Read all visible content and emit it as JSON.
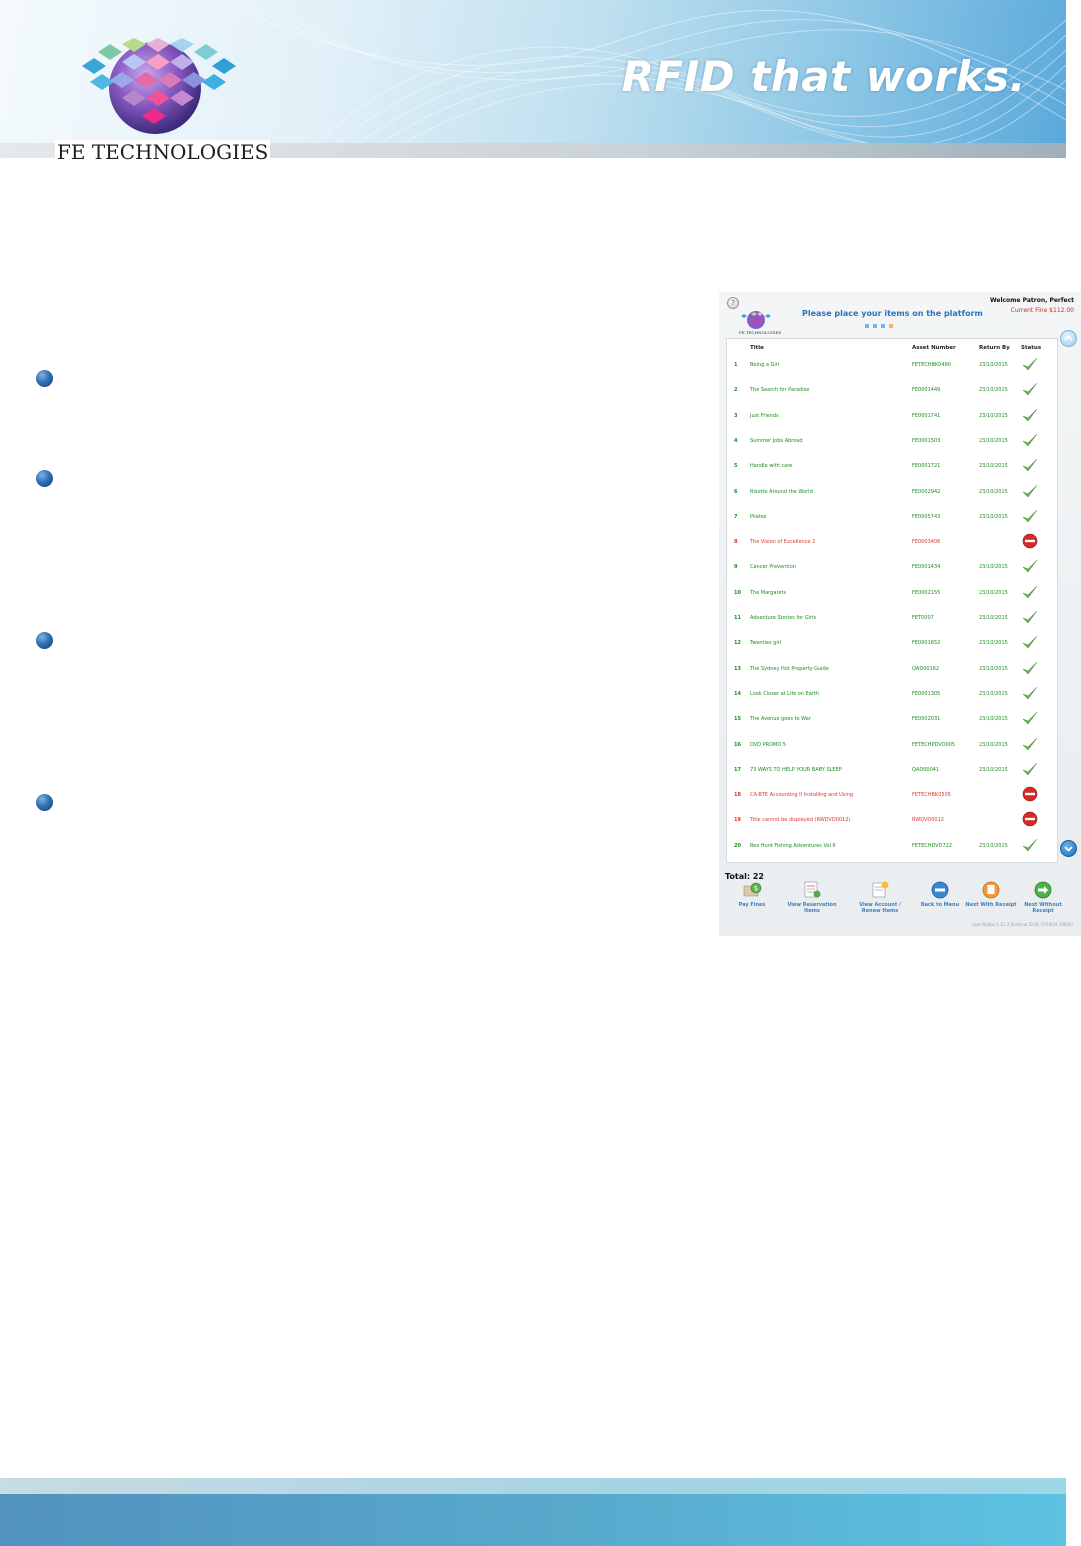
{
  "header": {
    "brand_name": "FE TECHNOLOGIES",
    "tagline": "RFID that works."
  },
  "kiosk": {
    "logo_text": "FE TECHNOLOGIES",
    "prompt": "Please place your items on the platform",
    "welcome": "Welcome Patron, Perfect",
    "current_fine": "Current Fine $112.00",
    "columns": {
      "title": "Title",
      "asset": "Asset Number",
      "return_by": "Return By",
      "status": "Status"
    },
    "total": "Total: 22",
    "status_icons": {
      "ok": "checkmark-icon",
      "error": "stop-icon"
    },
    "colors": {
      "ok": "#1f8b1f",
      "error": "#d63a2a",
      "accent": "#2a74bb"
    },
    "buttons": [
      {
        "label": "Pay Fines",
        "icon": "money-icon"
      },
      {
        "label": "View Reservation Items",
        "icon": "reservation-list-icon"
      },
      {
        "label": "View Account / Renew Items",
        "icon": "account-renew-icon"
      },
      {
        "label": "Back to Menu",
        "icon": "back-arrow-icon"
      },
      {
        "label": "Next With Receipt",
        "icon": "receipt-icon"
      },
      {
        "label": "Next Without Receipt",
        "icon": "next-arrow-icon"
      }
    ],
    "version": "User Status 1.21.3 Terminal ID 01 (7/29/19 19000)",
    "rows": [
      {
        "n": "1",
        "title": "Being a Girl",
        "asset": "FETECHBK0480",
        "ret": "23/10/2015",
        "ok": true
      },
      {
        "n": "2",
        "title": "The Search for Paradise",
        "asset": "FE0001449",
        "ret": "23/10/2015",
        "ok": true
      },
      {
        "n": "3",
        "title": "Just Friends",
        "asset": "FE0001741",
        "ret": "23/10/2015",
        "ok": true
      },
      {
        "n": "4",
        "title": "Summer Jobs Abroad",
        "asset": "FE0001503",
        "ret": "23/10/2015",
        "ok": true
      },
      {
        "n": "5",
        "title": "Handle with care",
        "asset": "FE0001721",
        "ret": "23/10/2015",
        "ok": true
      },
      {
        "n": "6",
        "title": "Risotto Around the World",
        "asset": "FE0002942",
        "ret": "23/10/2015",
        "ok": true
      },
      {
        "n": "7",
        "title": "Pilates",
        "asset": "FE0005743",
        "ret": "23/10/2015",
        "ok": true
      },
      {
        "n": "8",
        "title": "The Vision of Excellence 2",
        "asset": "FE0003406",
        "ret": "",
        "ok": false
      },
      {
        "n": "9",
        "title": "Cancer Prevention",
        "asset": "FE0001434",
        "ret": "23/10/2015",
        "ok": true
      },
      {
        "n": "10",
        "title": "The Margarets",
        "asset": "FE0002155",
        "ret": "23/10/2015",
        "ok": true
      },
      {
        "n": "11",
        "title": "Adventure Stories for Girls",
        "asset": "FET0007",
        "ret": "23/10/2015",
        "ok": true
      },
      {
        "n": "12",
        "title": "Twenties girl",
        "asset": "FE0001652",
        "ret": "23/10/2015",
        "ok": true
      },
      {
        "n": "13",
        "title": "The Sydney Hot Property Guide",
        "asset": "QAD00162",
        "ret": "23/10/2015",
        "ok": true
      },
      {
        "n": "14",
        "title": "Look Closer at Life on Earth",
        "asset": "FE0001305",
        "ret": "23/10/2015",
        "ok": true
      },
      {
        "n": "15",
        "title": "The Avenue goes to War",
        "asset": "FE0002031",
        "ret": "23/10/2015",
        "ok": true
      },
      {
        "n": "16",
        "title": "DVD PROMO 5",
        "asset": "FETECHPDVD005",
        "ret": "23/10/2015",
        "ok": true
      },
      {
        "n": "17",
        "title": "73 WAYS TO HELP YOUR BABY SLEEP",
        "asset": "QAD00041",
        "ret": "23/10/2015",
        "ok": true
      },
      {
        "n": "18",
        "title": "CA-BTE Accounting II Installing and Using",
        "asset": "FETECHBK0505",
        "ret": "",
        "ok": false
      },
      {
        "n": "19",
        "title": "Title cannot be displayed (RWDVD0012)",
        "asset": "RWDVD0012",
        "ret": "",
        "ok": false
      },
      {
        "n": "20",
        "title": "Rex Hunt Fishing Adventures Vol 6",
        "asset": "FETECHDVD722",
        "ret": "23/10/2015",
        "ok": true
      }
    ]
  }
}
